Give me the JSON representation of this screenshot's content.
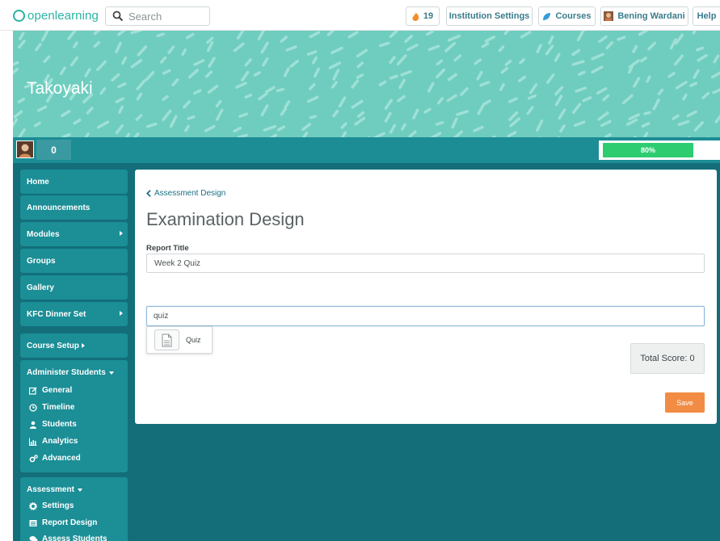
{
  "topbar": {
    "logo_text": "openlearning",
    "search_placeholder": "Search",
    "notifications_count": "19",
    "institution_settings_label": "Institution Settings",
    "courses_label": "Courses",
    "user_name": "Bening Wardani",
    "help_label": "Help"
  },
  "banner": {
    "course_title": "Takoyaki"
  },
  "userbar": {
    "points": "0",
    "progress_percent": 80,
    "progress_label": "80%"
  },
  "sidebar": {
    "items": [
      {
        "label": "Home",
        "has_arrow": false
      },
      {
        "label": "Announcements",
        "has_arrow": false
      },
      {
        "label": "Modules",
        "has_arrow": true
      },
      {
        "label": "Groups",
        "has_arrow": false
      },
      {
        "label": "Gallery",
        "has_arrow": false
      },
      {
        "label": "KFC Dinner Set",
        "has_arrow": true
      }
    ],
    "course_setup_label": "Course Setup",
    "administer": {
      "title": "Administer Students",
      "items": [
        {
          "label": "General",
          "icon": "edit-icon"
        },
        {
          "label": "Timeline",
          "icon": "clock-icon"
        },
        {
          "label": "Students",
          "icon": "user-icon"
        },
        {
          "label": "Analytics",
          "icon": "bar-chart-icon"
        },
        {
          "label": "Advanced",
          "icon": "gears-icon"
        }
      ]
    },
    "assessment": {
      "title": "Assessment",
      "items": [
        {
          "label": "Settings",
          "icon": "gear-icon"
        },
        {
          "label": "Report Design",
          "icon": "list-icon"
        },
        {
          "label": "Assess Students",
          "icon": "comments-icon"
        }
      ]
    }
  },
  "main": {
    "back_link": "Assessment Design",
    "page_title": "Examination Design",
    "report_title_label": "Report Title",
    "report_title_value": "Week 2 Quiz",
    "component_search_value": "quiz",
    "suggestion_label": "Quiz",
    "total_score": "Total Score: 0",
    "save_label": "Save"
  },
  "colors": {
    "brand_teal": "#2ab3a3",
    "banner": "#6ecdbf",
    "userbar": "#1c8c95",
    "main_bg": "#136e79",
    "sidebar_item": "#1b8e96",
    "progress": "#2ecc71",
    "save_button": "#f28c44",
    "link": "#1c6f84"
  }
}
